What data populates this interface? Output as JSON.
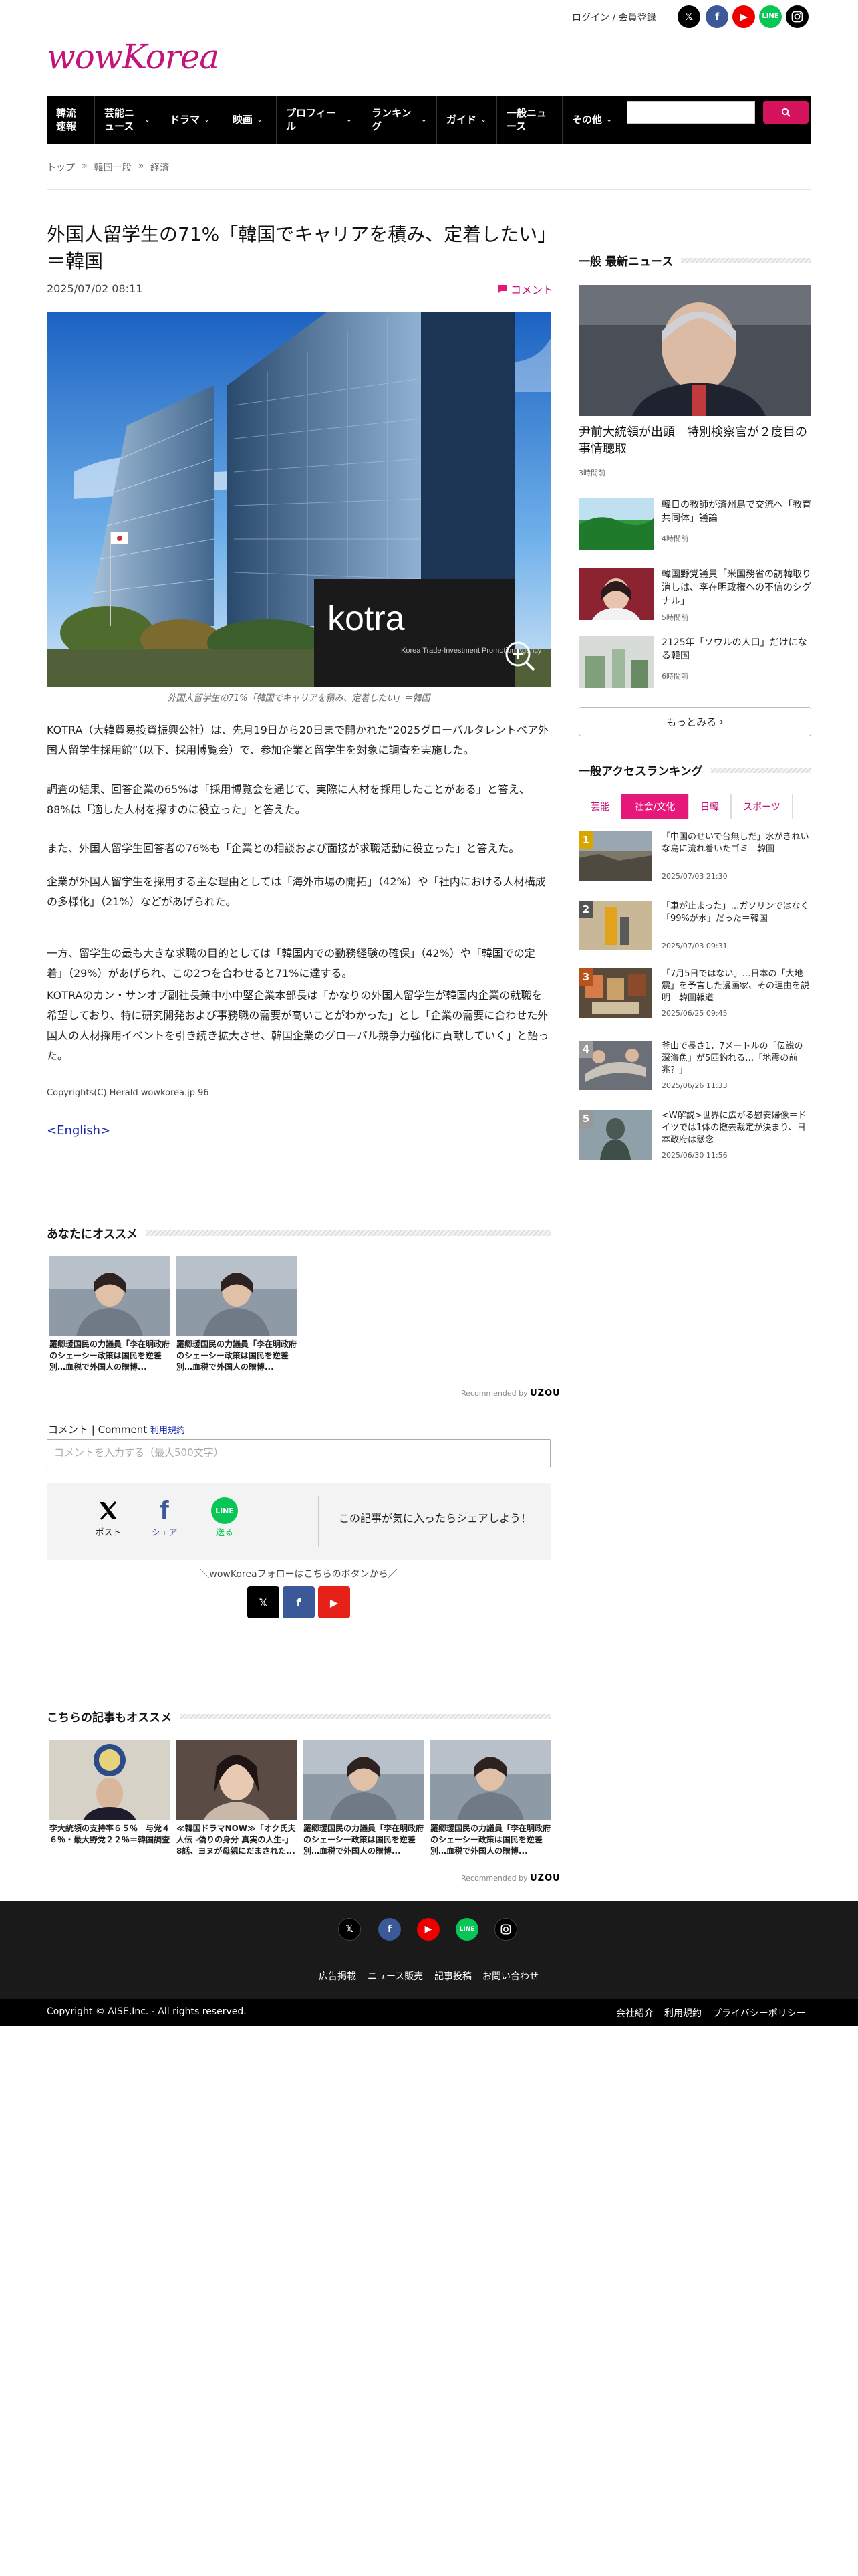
{
  "header": {
    "login": "ログイン / 会員登録",
    "social_icons": [
      "x-icon",
      "facebook-icon",
      "youtube-icon",
      "line-icon",
      "instagram-icon"
    ],
    "logo_text": "wowKorea",
    "brand_color": "#c4137a"
  },
  "nav": {
    "items": [
      {
        "label": "韓流速報",
        "has_menu": false
      },
      {
        "label": "芸能ニュース",
        "has_menu": true
      },
      {
        "label": "ドラマ",
        "has_menu": true
      },
      {
        "label": "映画",
        "has_menu": true
      },
      {
        "label": "プロフィール",
        "has_menu": true
      },
      {
        "label": "ランキング",
        "has_menu": true
      },
      {
        "label": "ガイド",
        "has_menu": true
      },
      {
        "label": "一般ニュース",
        "has_menu": false
      },
      {
        "label": "その他",
        "has_menu": true
      }
    ],
    "search_placeholder": "",
    "search_icon": "search-icon"
  },
  "breadcrumb": [
    "トップ",
    "韓国一般",
    "経済"
  ],
  "article": {
    "title": "外国人留学生の71%「韓国でキャリアを積み、定着したい」＝韓国",
    "date": "2025/07/02 08:11",
    "comment_link": "コメント",
    "photo_caption": "外国人留学生の71%「韓国でキャリアを積み、定着したい」＝韓国",
    "photo_sign_text": "kotra",
    "photo_sign_sub": "Korea Trade-Investment Promotion Agency",
    "paragraphs": [
      "KOTRA（大韓貿易投資振興公社）は、先月19日から20日まで開かれた“2025グローバルタレントベア外国人留学生採用館”（以下、採用博覧会）で、参加企業と留学生を対象に調査を実施した。",
      "調査の結果、回答企業の65%は「採用博覧会を通じて、実際に人材を採用したことがある」と答え、88%は「適した人材を探すのに役立った」と答えた。",
      "また、外国人留学生回答者の76%も「企業との相談および面接が求職活動に役立った」と答えた。",
      "企業が外国人留学生を採用する主な理由としては「海外市場の開拓」（42%）や「社内における人材構成の多様化」（21%）などがあげられた。",
      "一方、留学生の最も大きな求職の目的としては「韓国内での勤務経験の確保」（42%）や「韓国での定着」（29%）があげられ、この2つを合わせると71%に達する。",
      "KOTRAのカン・サンオブ副社長兼中小中堅企業本部長は「かなりの外国人留学生が韓国内企業の就職を希望しており、特に研究開発および事務職の需要が高いことがわかった」とし「企業の需要に合わせた外国人の人材採用イベントを引き続き拡大させ、韓国企業のグローバル競争力強化に貢献していく」と語った。"
    ],
    "copyright": "Copyrights(C) Herald wowkorea.jp   96",
    "english_link": "<English>"
  },
  "recommend1": {
    "heading": "あなたにオススメ",
    "items": [
      {
        "caption": "羅卿瑗国民の力議員「李在明政府のシェーシー政策は国民を逆差別…血税で外国人の贈博..."
      },
      {
        "caption": "羅卿瑗国民の力議員「李在明政府のシェーシー政策は国民を逆差別…血税で外国人の贈博..."
      }
    ],
    "recommended_by": "Recommended by",
    "uzou": "UZOU"
  },
  "comment": {
    "label": "コメント | Comment",
    "terms": "利用規約",
    "placeholder": "コメントを入力する（最大500文字）"
  },
  "share": {
    "items": [
      {
        "label": "ポスト",
        "icon": "x-icon"
      },
      {
        "label": "シェア",
        "icon": "facebook-icon"
      },
      {
        "label": "送る",
        "icon": "line-icon"
      }
    ],
    "text": "この記事が気に入ったらシェアしよう！",
    "follow": "＼wowKoreaフォローはこちらのボタンから／"
  },
  "recommend2": {
    "heading": "こちらの記事もオススメ",
    "items": [
      {
        "caption": "李大統領の支持率６５％　与党４６％・最大野党２２％＝韓国調査"
      },
      {
        "caption": "≪韓国ドラマNOW≫「オク氏夫人伝 -偽りの身分 真実の人生-」8話、ヨヌが母親にだまされた..."
      },
      {
        "caption": "羅卿瑗国民の力議員「李在明政府のシェーシー政策は国民を逆差別…血税で外国人の贈博..."
      },
      {
        "caption": "羅卿瑗国民の力議員「李在明政府のシェーシー政策は国民を逆差別…血税で外国人の贈博..."
      }
    ],
    "recommended_by": "Recommended by",
    "uzou": "UZOU"
  },
  "sidebar": {
    "latest_heading": "一般 最新ニュース",
    "featured": {
      "title": "尹前大統領が出頭　特別検察官が２度目の事情聴取",
      "meta": "3時間前"
    },
    "news": [
      {
        "title": "韓日の教師が済州島で交流へ「教育共同体」議論",
        "meta": "4時間前"
      },
      {
        "title": "韓国野党議員「米国務省の訪韓取り消しは、李在明政権への不信のシグナル」",
        "meta": "5時間前"
      },
      {
        "title": "2125年「ソウルの人口」だけになる韓国",
        "meta": "6時間前"
      }
    ],
    "more_button": "もっとみる",
    "ranking_heading": "一般アクセスランキング",
    "tabs": [
      {
        "label": "芸能",
        "active": false
      },
      {
        "label": "社会/文化",
        "active": true
      },
      {
        "label": "日韓",
        "active": false
      },
      {
        "label": "スポーツ",
        "active": false
      }
    ],
    "ranking": [
      {
        "num": "1",
        "title": "「中国のせいで台無しだ」水がきれいな島に流れ着いたゴミ＝韓国",
        "date": "2025/07/03 21:30",
        "color": "#d9a600"
      },
      {
        "num": "2",
        "title": "「車が止まった」…ガソリンではなく「99%が水」だった＝韓国",
        "date": "2025/07/03 09:31",
        "color": "#666"
      },
      {
        "num": "3",
        "title": "「7月5日ではない」…日本の「大地震」を予言した漫画家、その理由を説明＝韓国報道",
        "date": "2025/06/25 09:45",
        "color": "#b5531a"
      },
      {
        "num": "4",
        "title": "釜山で長さ1．7メートルの「伝説の深海魚」が5匹釣れる…「地震の前兆？」",
        "date": "2025/06/26 11:33",
        "color": "#999"
      },
      {
        "num": "5",
        "title": "<W解説>世界に広がる慰安婦像＝ドイツでは1体の撤去裁定が決まり、日本政府は懸念",
        "date": "2025/06/30 11:56",
        "color": "#999"
      }
    ]
  },
  "footer": {
    "links": [
      "広告掲載",
      "ニュース販売",
      "記事投稿",
      "お問い合わせ"
    ],
    "copyright": "Copyright © AISE,Inc. - All rights reserved.",
    "bottom_links": [
      "会社紹介",
      "利用規約",
      "プライバシーポリシー"
    ]
  }
}
